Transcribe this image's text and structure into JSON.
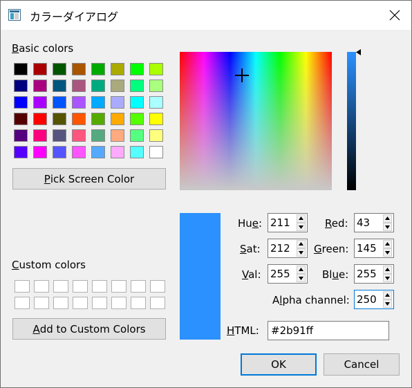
{
  "window": {
    "title": "カラーダイアログ"
  },
  "basic_colors": {
    "label_key": "B",
    "label_rest": "asic colors",
    "colors": [
      "#000000",
      "#aa0000",
      "#005500",
      "#aa5500",
      "#00aa00",
      "#aaaa00",
      "#00ff00",
      "#aaff00",
      "#00007f",
      "#aa007f",
      "#00557f",
      "#aa557f",
      "#00aa7f",
      "#aaaa7f",
      "#00ff7f",
      "#aaff7f",
      "#0000ff",
      "#aa00ff",
      "#0055ff",
      "#aa55ff",
      "#00aaff",
      "#aaaaff",
      "#00ffff",
      "#aaffff",
      "#550000",
      "#ff0000",
      "#555500",
      "#ff5500",
      "#55aa00",
      "#ffaa00",
      "#55ff00",
      "#ffff00",
      "#55007f",
      "#ff007f",
      "#55557f",
      "#ff557f",
      "#55aa7f",
      "#ffaa7f",
      "#55ff7f",
      "#ffff7f",
      "#5500ff",
      "#ff00ff",
      "#5555ff",
      "#ff55ff",
      "#55aaff",
      "#ffaaff",
      "#55ffff",
      "#ffffff"
    ]
  },
  "pick_screen": {
    "key": "P",
    "rest": "ick Screen Color"
  },
  "custom_colors": {
    "label_key": "C",
    "label_rest": "ustom colors",
    "count": 16
  },
  "add_custom": {
    "key": "A",
    "rest": "dd to Custom Colors"
  },
  "current_color": "#2b91ff",
  "fields": {
    "hue": {
      "pre": "Hu",
      "key": "e",
      "post": ":",
      "value": "211"
    },
    "sat": {
      "pre": "",
      "key": "S",
      "post": "at:",
      "value": "212"
    },
    "val": {
      "pre": "",
      "key": "V",
      "post": "al:",
      "value": "255"
    },
    "red": {
      "pre": "",
      "key": "R",
      "post": "ed:",
      "value": "43"
    },
    "green": {
      "pre": "",
      "key": "G",
      "post": "reen:",
      "value": "145"
    },
    "blue": {
      "pre": "Bl",
      "key": "u",
      "post": "e:",
      "value": "255"
    },
    "alpha": {
      "pre": "A",
      "key": "l",
      "post": "pha channel:",
      "value": "250"
    }
  },
  "html": {
    "key": "H",
    "rest": "TML:",
    "value": "#2b91ff"
  },
  "buttons": {
    "ok": "OK",
    "cancel": "Cancel"
  }
}
